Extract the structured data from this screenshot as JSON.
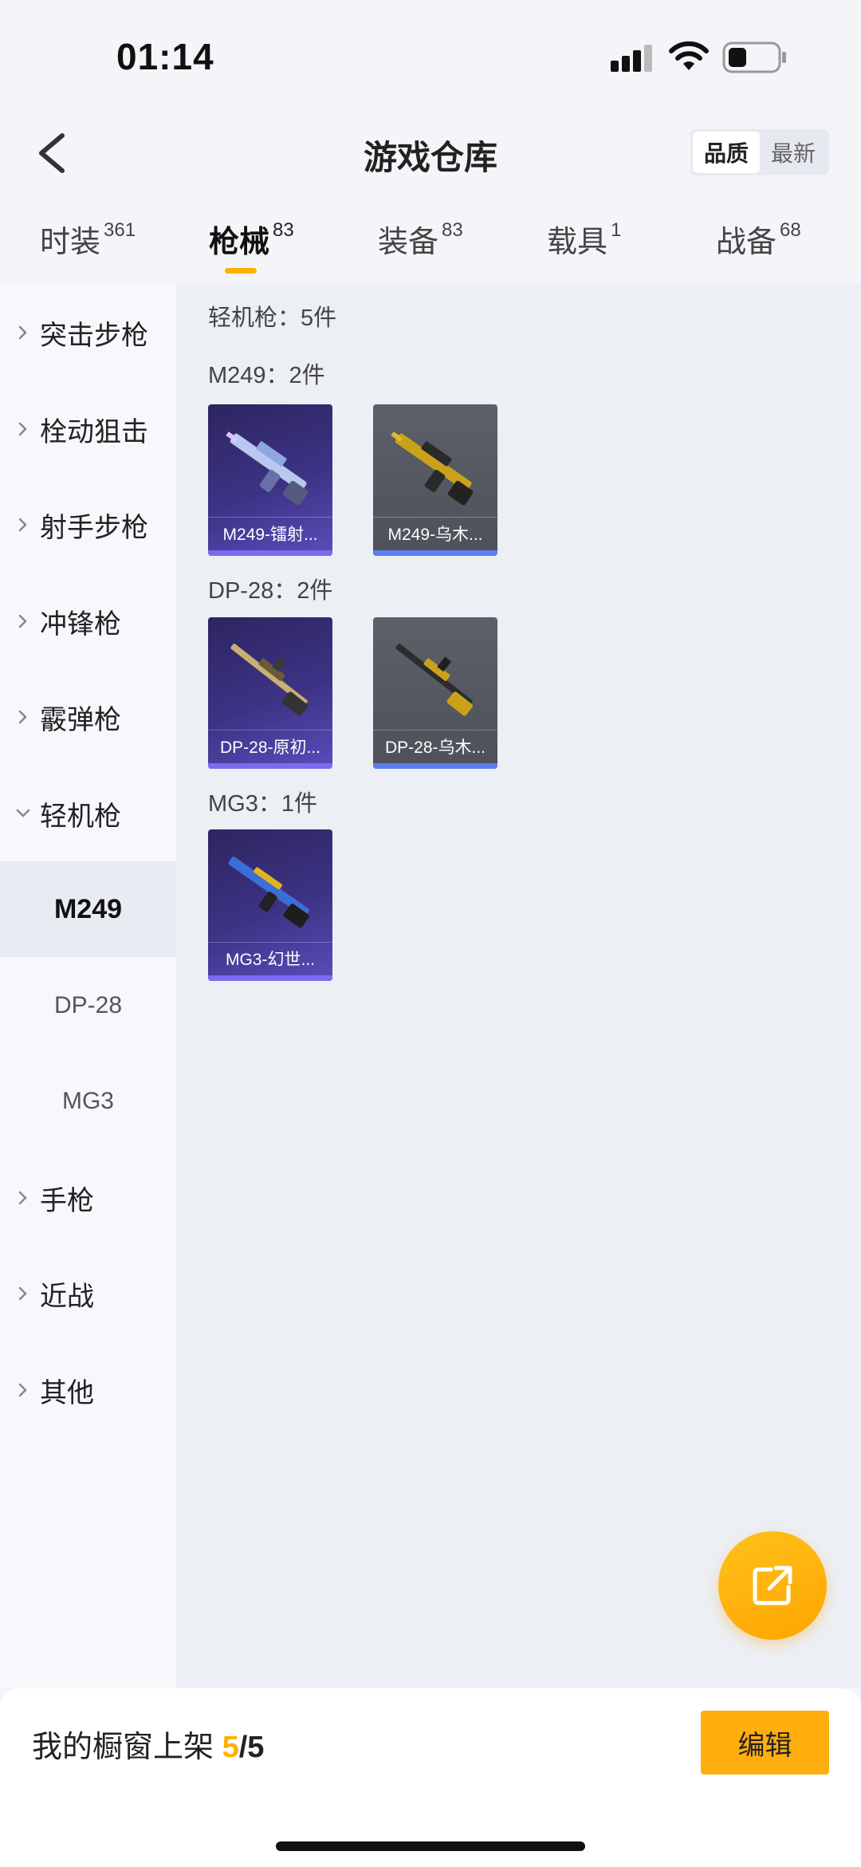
{
  "status_bar": {
    "time": "01:14"
  },
  "header": {
    "title": "游戏仓库",
    "sort_options": [
      {
        "label": "品质",
        "active": true
      },
      {
        "label": "最新",
        "active": false
      }
    ]
  },
  "tabs": [
    {
      "label": "时装",
      "count": "361"
    },
    {
      "label": "枪械",
      "count": "83",
      "active": true
    },
    {
      "label": "装备",
      "count": "83"
    },
    {
      "label": "载具",
      "count": "1"
    },
    {
      "label": "战备",
      "count": "68"
    }
  ],
  "sidebar": {
    "categories": [
      {
        "label": "突击步枪"
      },
      {
        "label": "栓动狙击"
      },
      {
        "label": "射手步枪"
      },
      {
        "label": "冲锋枪"
      },
      {
        "label": "霰弹枪"
      },
      {
        "label": "轻机枪",
        "expanded": true
      },
      {
        "label": "手枪"
      },
      {
        "label": "近战"
      },
      {
        "label": "其他"
      }
    ],
    "sub_items": [
      {
        "label": "M249",
        "active": true
      },
      {
        "label": "DP-28"
      },
      {
        "label": "MG3"
      }
    ]
  },
  "content": {
    "category_summary": "轻机枪：5件",
    "groups": [
      {
        "heading": "M249：2件",
        "items": [
          {
            "name": "M249-镭射...",
            "rarity": "purple",
            "icon": "machine-gun-icon"
          },
          {
            "name": "M249-乌木...",
            "rarity": "gray",
            "icon": "machine-gun-icon"
          }
        ]
      },
      {
        "heading": "DP-28：2件",
        "items": [
          {
            "name": "DP-28-原初...",
            "rarity": "purple",
            "icon": "machine-gun-icon"
          },
          {
            "name": "DP-28-乌木...",
            "rarity": "gray",
            "icon": "machine-gun-icon"
          }
        ]
      },
      {
        "heading": "MG3：1件",
        "items": [
          {
            "name": "MG3-幻世...",
            "rarity": "purple",
            "icon": "machine-gun-icon"
          }
        ]
      }
    ]
  },
  "bottom_bar": {
    "showcase_label": "我的橱窗上架",
    "count": "5",
    "total": "/5",
    "edit_label": "编辑"
  },
  "colors": {
    "accent": "#ffb000",
    "edit_button": "#ffae0e",
    "rarity_purple": "#3d3386",
    "rarity_gray": "#5c6069"
  }
}
